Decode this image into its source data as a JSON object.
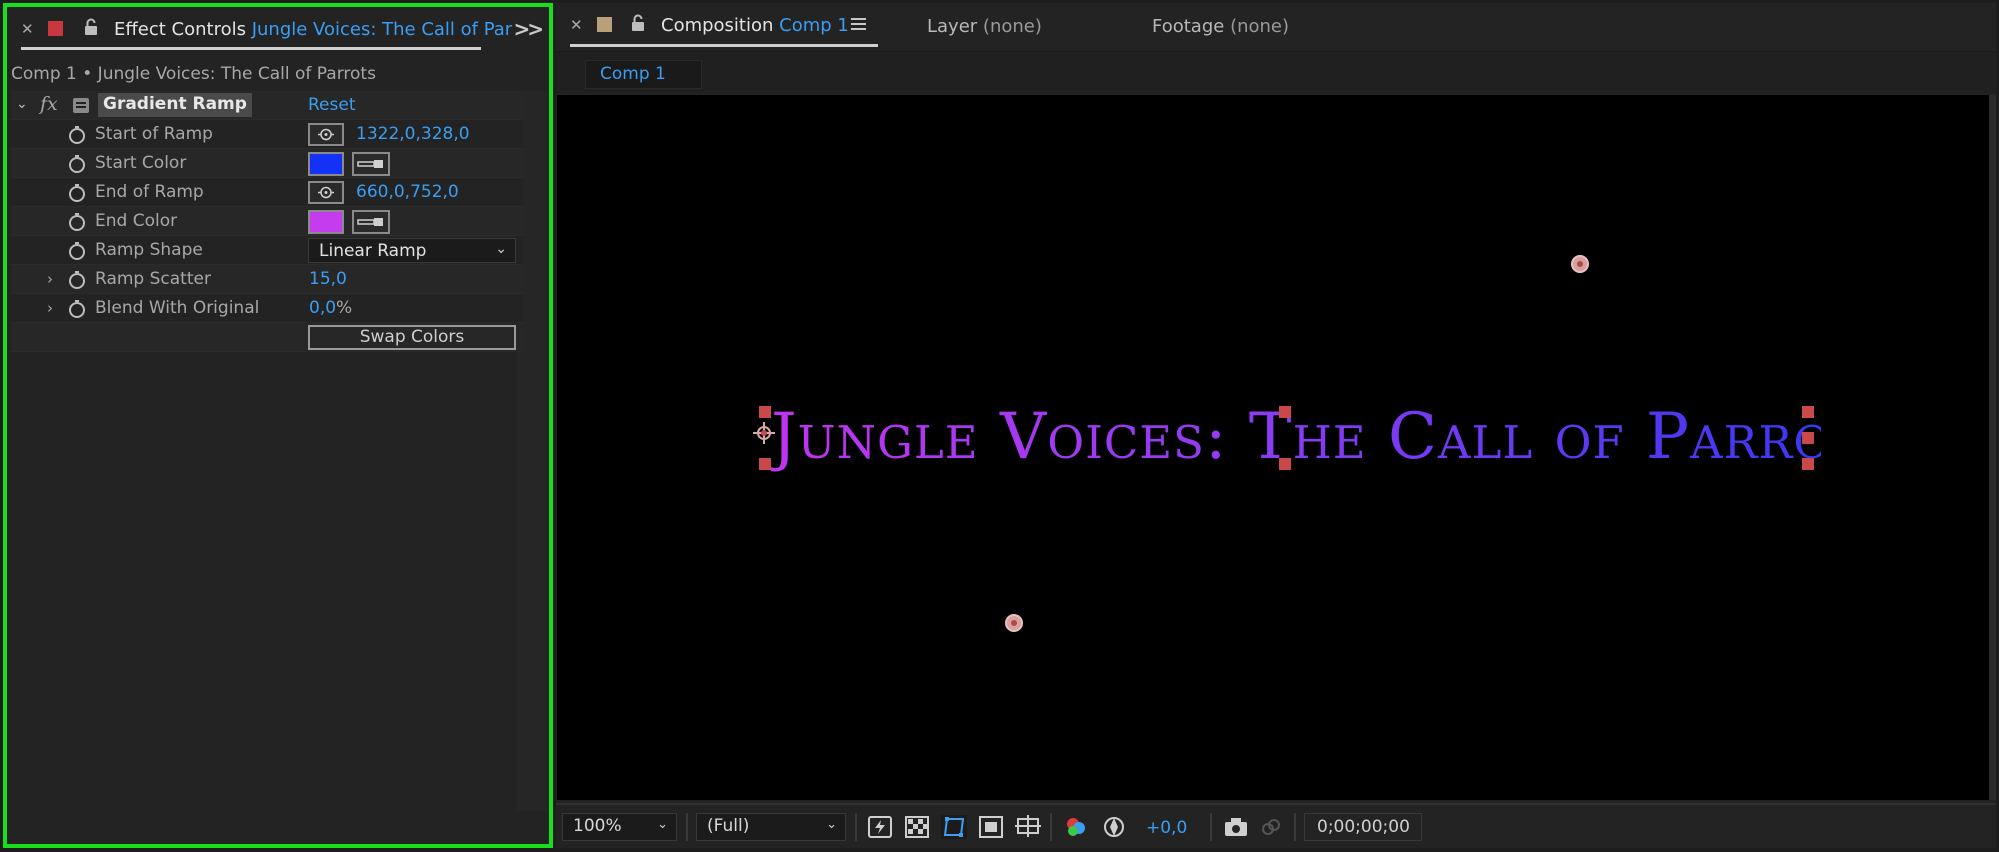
{
  "effect_controls": {
    "tab_label": "Effect Controls",
    "tab_layer": "Jungle Voices: The Call of Par",
    "breadcrumb": "Comp 1 • Jungle Voices: The Call of Parrots",
    "effect": {
      "fx_label": "fx",
      "name": "Gradient Ramp",
      "reset_label": "Reset"
    },
    "properties": [
      {
        "label": "Start of Ramp",
        "value": "1322,0,328,0"
      },
      {
        "label": "Start Color",
        "color": "#1432f5"
      },
      {
        "label": "End of Ramp",
        "value": "660,0,752,0"
      },
      {
        "label": "End Color",
        "color": "#c43cf0"
      },
      {
        "label": "Ramp Shape",
        "value": "Linear Ramp"
      },
      {
        "label": "Ramp Scatter",
        "value": "15,0"
      },
      {
        "label": "Blend With Original",
        "value": "0,0",
        "unit": "%"
      }
    ],
    "swap_colors_label": "Swap Colors"
  },
  "composition": {
    "tab_label": "Composition",
    "tab_comp": "Comp 1",
    "layer_tab": {
      "label": "Layer",
      "value": "(none)"
    },
    "footage_tab": {
      "label": "Footage",
      "value": "(none)"
    },
    "subtab_label": "Comp 1",
    "viewer_text": "Jungle Voices: The Call of Parrots",
    "toolbar": {
      "zoom": "100%",
      "resolution": "(Full)",
      "exposure": "+0,0",
      "timecode": "0;00;00;00"
    }
  },
  "colors": {
    "highlight_border": "#16e01c",
    "accent_blue": "#3a9ef3",
    "handle_red": "#c9494a"
  }
}
